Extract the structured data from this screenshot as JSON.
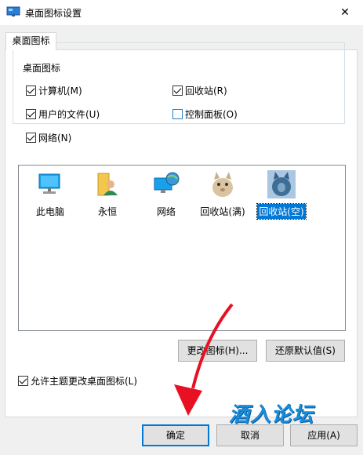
{
  "window": {
    "title": "桌面图标设置",
    "close_glyph": "✕"
  },
  "tabs": [
    {
      "label": "桌面图标"
    }
  ],
  "group": {
    "legend": "桌面图标",
    "checkboxes": [
      {
        "label": "计算机(M)",
        "checked": true
      },
      {
        "label": "回收站(R)",
        "checked": true
      },
      {
        "label": "用户的文件(U)",
        "checked": true
      },
      {
        "label": "控制面板(O)",
        "checked": false
      },
      {
        "label": "网络(N)",
        "checked": true
      }
    ]
  },
  "icons": [
    {
      "label": "此电脑",
      "icon": "this-pc-icon"
    },
    {
      "label": "永恒",
      "icon": "user-folder-icon"
    },
    {
      "label": "网络",
      "icon": "network-icon"
    },
    {
      "label": "回收站(满)",
      "icon": "recycle-bin-full-icon"
    },
    {
      "label": "回收站(空)",
      "icon": "recycle-bin-empty-icon",
      "selected": true
    }
  ],
  "buttons": {
    "change_icon": "更改图标(H)...",
    "restore_default": "还原默认值(S)",
    "ok": "确定",
    "cancel": "取消",
    "apply": "应用(A)"
  },
  "allow_themes": {
    "label": "允许主题更改桌面图标(L)",
    "checked": true
  },
  "watermark": "酒入论坛",
  "colors": {
    "accent": "#0078d7",
    "arrow": "#e81123"
  }
}
